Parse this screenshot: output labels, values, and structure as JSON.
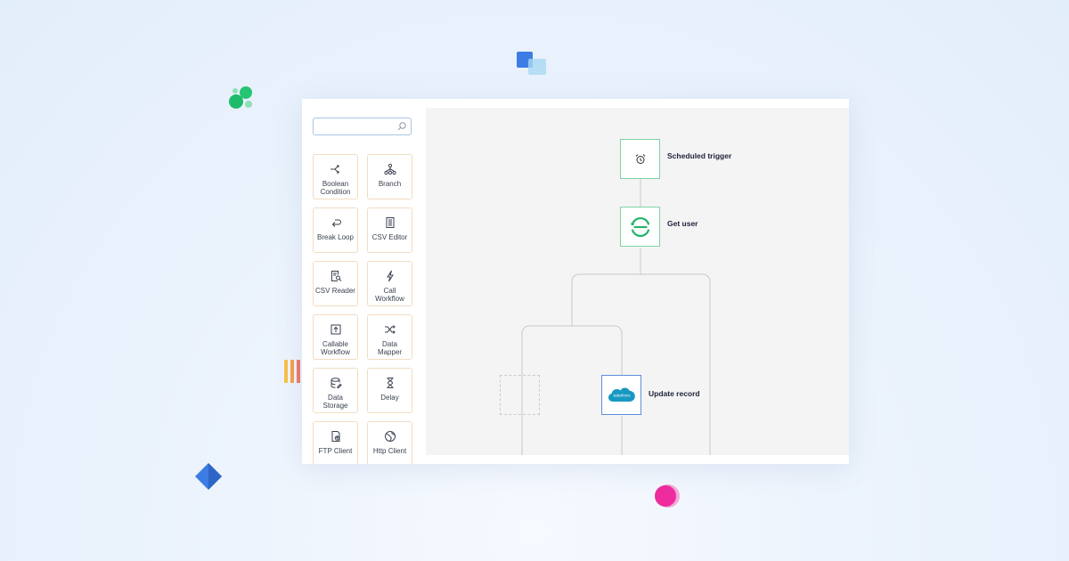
{
  "search": {
    "placeholder": ""
  },
  "toolbox": {
    "items": [
      {
        "label": "Boolean Condition",
        "icon": "branch-arrows-icon"
      },
      {
        "label": "Branch",
        "icon": "tree-icon"
      },
      {
        "label": "Break Loop",
        "icon": "return-arrow-icon"
      },
      {
        "label": "CSV Editor",
        "icon": "document-icon"
      },
      {
        "label": "CSV Reader",
        "icon": "document-search-icon"
      },
      {
        "label": "Call Workflow",
        "icon": "lightning-icon"
      },
      {
        "label": "Callable Workflow",
        "icon": "upload-box-icon"
      },
      {
        "label": "Data Mapper",
        "icon": "shuffle-icon"
      },
      {
        "label": "Data Storage",
        "icon": "database-icon"
      },
      {
        "label": "Delay",
        "icon": "hourglass-icon"
      },
      {
        "label": "FTP Client",
        "icon": "file-upload-icon"
      },
      {
        "label": "Http Client",
        "icon": "globe-icon"
      }
    ]
  },
  "workflow": {
    "nodes": [
      {
        "label": "Scheduled trigger",
        "icon": "alarm-clock-icon"
      },
      {
        "label": "Get user",
        "icon": "sync-logo-icon"
      },
      {
        "label": "Update record",
        "icon": "salesforce-logo-icon",
        "logo_text": "salesforce"
      }
    ]
  },
  "colors": {
    "node_border_green": "#7ed3a3",
    "node_border_blue": "#5c8fd6",
    "tile_border": "#f3dcc3",
    "salesforce_blue": "#1798c1"
  }
}
